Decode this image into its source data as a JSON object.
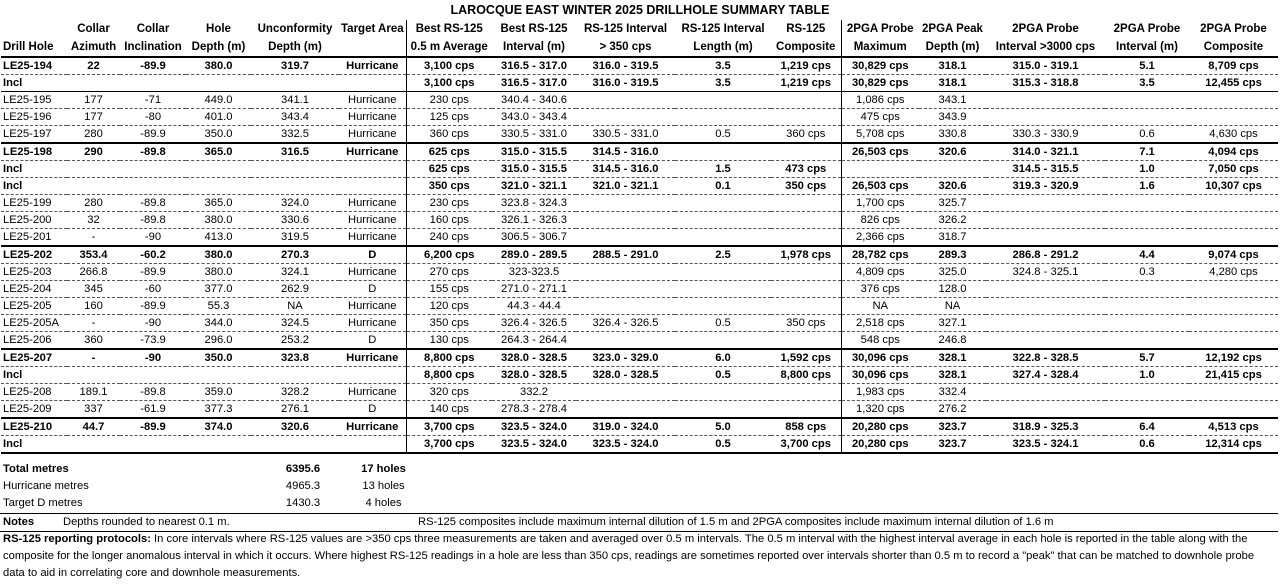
{
  "title": "LAROCQUE EAST WINTER 2025 DRILLHOLE SUMMARY TABLE",
  "headers": [
    [
      "",
      "Collar",
      "Collar",
      "Hole",
      "Unconformity",
      "Target Area",
      "Best RS-125",
      "Best RS-125",
      "RS-125 Interval",
      "RS-125 Interval",
      "RS-125",
      "2PGA Probe",
      "2PGA Peak",
      "2PGA Probe",
      "2PGA Probe",
      "2PGA Probe"
    ],
    [
      "Drill Hole",
      "Azimuth",
      "Inclination",
      "Depth (m)",
      "Depth (m)",
      "",
      "0.5 m Average",
      "Interval (m)",
      "> 350 cps",
      "Length (m)",
      "Composite",
      "Maximum",
      "Depth (m)",
      "Interval >3000 cps",
      "Interval  (m)",
      "Composite"
    ]
  ],
  "rows": [
    [
      "LE25-194",
      "22",
      "-89.9",
      "380.0",
      "319.7",
      "Hurricane",
      "3,100 cps",
      "316.5 - 317.0",
      "316.0 - 319.5",
      "3.5",
      "1,219 cps",
      "30,829 cps",
      "318.1",
      "315.0 - 319.1",
      "5.1",
      "8,709 cps"
    ],
    [
      "Incl",
      "",
      "",
      "",
      "",
      "",
      "3,100 cps",
      "316.5 - 317.0",
      "316.0 - 319.5",
      "3.5",
      "1,219 cps",
      "30,829 cps",
      "318.1",
      "315.3 - 318.8",
      "3.5",
      "12,455 cps"
    ],
    [
      "LE25-195",
      "177",
      "-71",
      "449.0",
      "341.1",
      "Hurricane",
      "230 cps",
      "340.4 - 340.6",
      "",
      "",
      "",
      "1,086 cps",
      "343.1",
      "",
      "",
      ""
    ],
    [
      "LE25-196",
      "177",
      "-80",
      "401.0",
      "343.4",
      "Hurricane",
      "125 cps",
      "343.0 - 343.4",
      "",
      "",
      "",
      "475 cps",
      "343.9",
      "",
      "",
      ""
    ],
    [
      "LE25-197",
      "280",
      "-89.9",
      "350.0",
      "332.5",
      "Hurricane",
      "360 cps",
      "330.5 - 331.0",
      "330.5 - 331.0",
      "0.5",
      "360 cps",
      "5,708 cps",
      "330.8",
      "330.3 - 330.9",
      "0.6",
      "4,630 cps"
    ],
    [
      "LE25-198",
      "290",
      "-89.8",
      "365.0",
      "316.5",
      "Hurricane",
      "625 cps",
      "315.0 - 315.5",
      "314.5 - 316.0",
      "",
      "",
      "26,503 cps",
      "320.6",
      "314.0 - 321.1",
      "7.1",
      "4,094 cps"
    ],
    [
      "Incl",
      "",
      "",
      "",
      "",
      "",
      "625 cps",
      "315.0 - 315.5",
      "314.5 - 316.0",
      "1.5",
      "473 cps",
      "",
      "",
      "314.5 - 315.5",
      "1.0",
      "7,050 cps"
    ],
    [
      "Incl",
      "",
      "",
      "",
      "",
      "",
      "350 cps",
      "321.0 - 321.1",
      "321.0 - 321.1",
      "0.1",
      "350 cps",
      "26,503 cps",
      "320.6",
      "319.3 - 320.9",
      "1.6",
      "10,307 cps"
    ],
    [
      "LE25-199",
      "280",
      "-89.8",
      "365.0",
      "324.0",
      "Hurricane",
      "230 cps",
      "323.8 - 324.3",
      "",
      "",
      "",
      "1,700 cps",
      "325.7",
      "",
      "",
      ""
    ],
    [
      "LE25-200",
      "32",
      "-89.8",
      "380.0",
      "330.6",
      "Hurricane",
      "160 cps",
      "326.1 - 326.3",
      "",
      "",
      "",
      "826 cps",
      "326.2",
      "",
      "",
      ""
    ],
    [
      "LE25-201",
      "-",
      "-90",
      "413.0",
      "319.5",
      "Hurricane",
      "240 cps",
      "306.5 - 306.7",
      "",
      "",
      "",
      "2,366 cps",
      "318.7",
      "",
      "",
      ""
    ],
    [
      "LE25-202",
      "353.4",
      "-60.2",
      "380.0",
      "270.3",
      "D",
      "6,200 cps",
      "289.0 - 289.5",
      "288.5  - 291.0",
      "2.5",
      "1,978 cps",
      "28,782 cps",
      "289.3",
      "286.8 - 291.2",
      "4.4",
      "9,074 cps"
    ],
    [
      "LE25-203",
      "266.8",
      "-89.9",
      "380.0",
      "324.1",
      "Hurricane",
      "270 cps",
      "323-323.5",
      "",
      "",
      "",
      "4,809 cps",
      "325.0",
      "324.8 - 325.1",
      "0.3",
      "4,280 cps"
    ],
    [
      "LE25-204",
      "345",
      "-60",
      "377.0",
      "262.9",
      "D",
      "155 cps",
      "271.0 - 271.1",
      "",
      "",
      "",
      "376 cps",
      "128.0",
      "",
      "",
      ""
    ],
    [
      "LE25-205",
      "160",
      "-89.9",
      "55.3",
      "NA",
      "Hurricane",
      "120 cps",
      "44.3 - 44.4",
      "",
      "",
      "",
      "NA",
      "NA",
      "",
      "",
      ""
    ],
    [
      "LE25-205A",
      "-",
      "-90",
      "344.0",
      "324.5",
      "Hurricane",
      "350 cps",
      "326.4 - 326.5",
      "326.4 - 326.5",
      "0.5",
      "350 cps",
      "2,518 cps",
      "327.1",
      "",
      "",
      ""
    ],
    [
      "LE25-206",
      "360",
      "-73.9",
      "296.0",
      "253.2",
      "D",
      "130 cps",
      "264.3 - 264.4",
      "",
      "",
      "",
      "548 cps",
      "246.8",
      "",
      "",
      ""
    ],
    [
      "LE25-207",
      "-",
      "-90",
      "350.0",
      "323.8",
      "Hurricane",
      "8,800 cps",
      "328.0 - 328.5",
      "323.0 - 329.0",
      "6.0",
      "1,592 cps",
      "30,096 cps",
      "328.1",
      "322.8 - 328.5",
      "5.7",
      "12,192 cps"
    ],
    [
      "Incl",
      "",
      "",
      "",
      "",
      "",
      "8,800 cps",
      "328.0 - 328.5",
      "328.0 - 328.5",
      "0.5",
      "8,800 cps",
      "30,096 cps",
      "328.1",
      "327.4 - 328.4",
      "1.0",
      "21,415 cps"
    ],
    [
      "LE25-208",
      "189.1",
      "-89.8",
      "359.0",
      "328.2",
      "Hurricane",
      "320 cps",
      "332.2",
      "",
      "",
      "",
      "1,983 cps",
      "332.4",
      "",
      "",
      ""
    ],
    [
      "LE25-209",
      "337",
      "-61.9",
      "377.3",
      "276.1",
      "D",
      "140 cps",
      "278.3 - 278.4",
      "",
      "",
      "",
      "1,320 cps",
      "276.2",
      "",
      "",
      ""
    ],
    [
      "LE25-210",
      "44.7",
      "-89.9",
      "374.0",
      "320.6",
      "Hurricane",
      "3,700 cps",
      "323.5 - 324.0",
      "319.0 - 324.0",
      "5.0",
      "858 cps",
      "20,280 cps",
      "323.7",
      "318.9 - 325.3",
      "6.4",
      "4,513 cps"
    ],
    [
      "Incl",
      "",
      "",
      "",
      "",
      "",
      "3,700 cps",
      "323.5 - 324.0",
      "323.5 - 324.0",
      "0.5",
      "3,700 cps",
      "20,280 cps",
      "323.7",
      "323.5 - 324.1",
      "0.6",
      "12,314 cps"
    ]
  ],
  "totals": [
    {
      "label": "Total metres",
      "metres": "6395.6",
      "holes": "17 holes"
    },
    {
      "label": "Hurricane metres",
      "metres": "4965.3",
      "holes": "13 holes"
    },
    {
      "label": "Target D metres",
      "metres": "1430.3",
      "holes": "4 holes"
    }
  ],
  "notes": {
    "label": "Notes",
    "depths": "Depths rounded to nearest 0.1 m.",
    "composites": "RS-125 composites include maximum internal dilution of  1.5 m and 2PGA composites include maximum internal dilution of  1.6 m"
  },
  "protocol": {
    "label": "RS-125 reporting protocols:",
    "text": " In core intervals where RS-125 values are >350 cps three measurements are taken and averaged over 0.5 m intervals. The 0.5 m interval with the highest interval average in each hole is reported in the table along with the composite for the longer anomalous interval in which it occurs. Where highest RS-125 readings in a hole are less than 350 cps, readings are sometimes reported over intervals shorter than 0.5 m to record a \"peak\" that can be matched to downhole probe data to aid in correlating core and downhole measurements."
  }
}
